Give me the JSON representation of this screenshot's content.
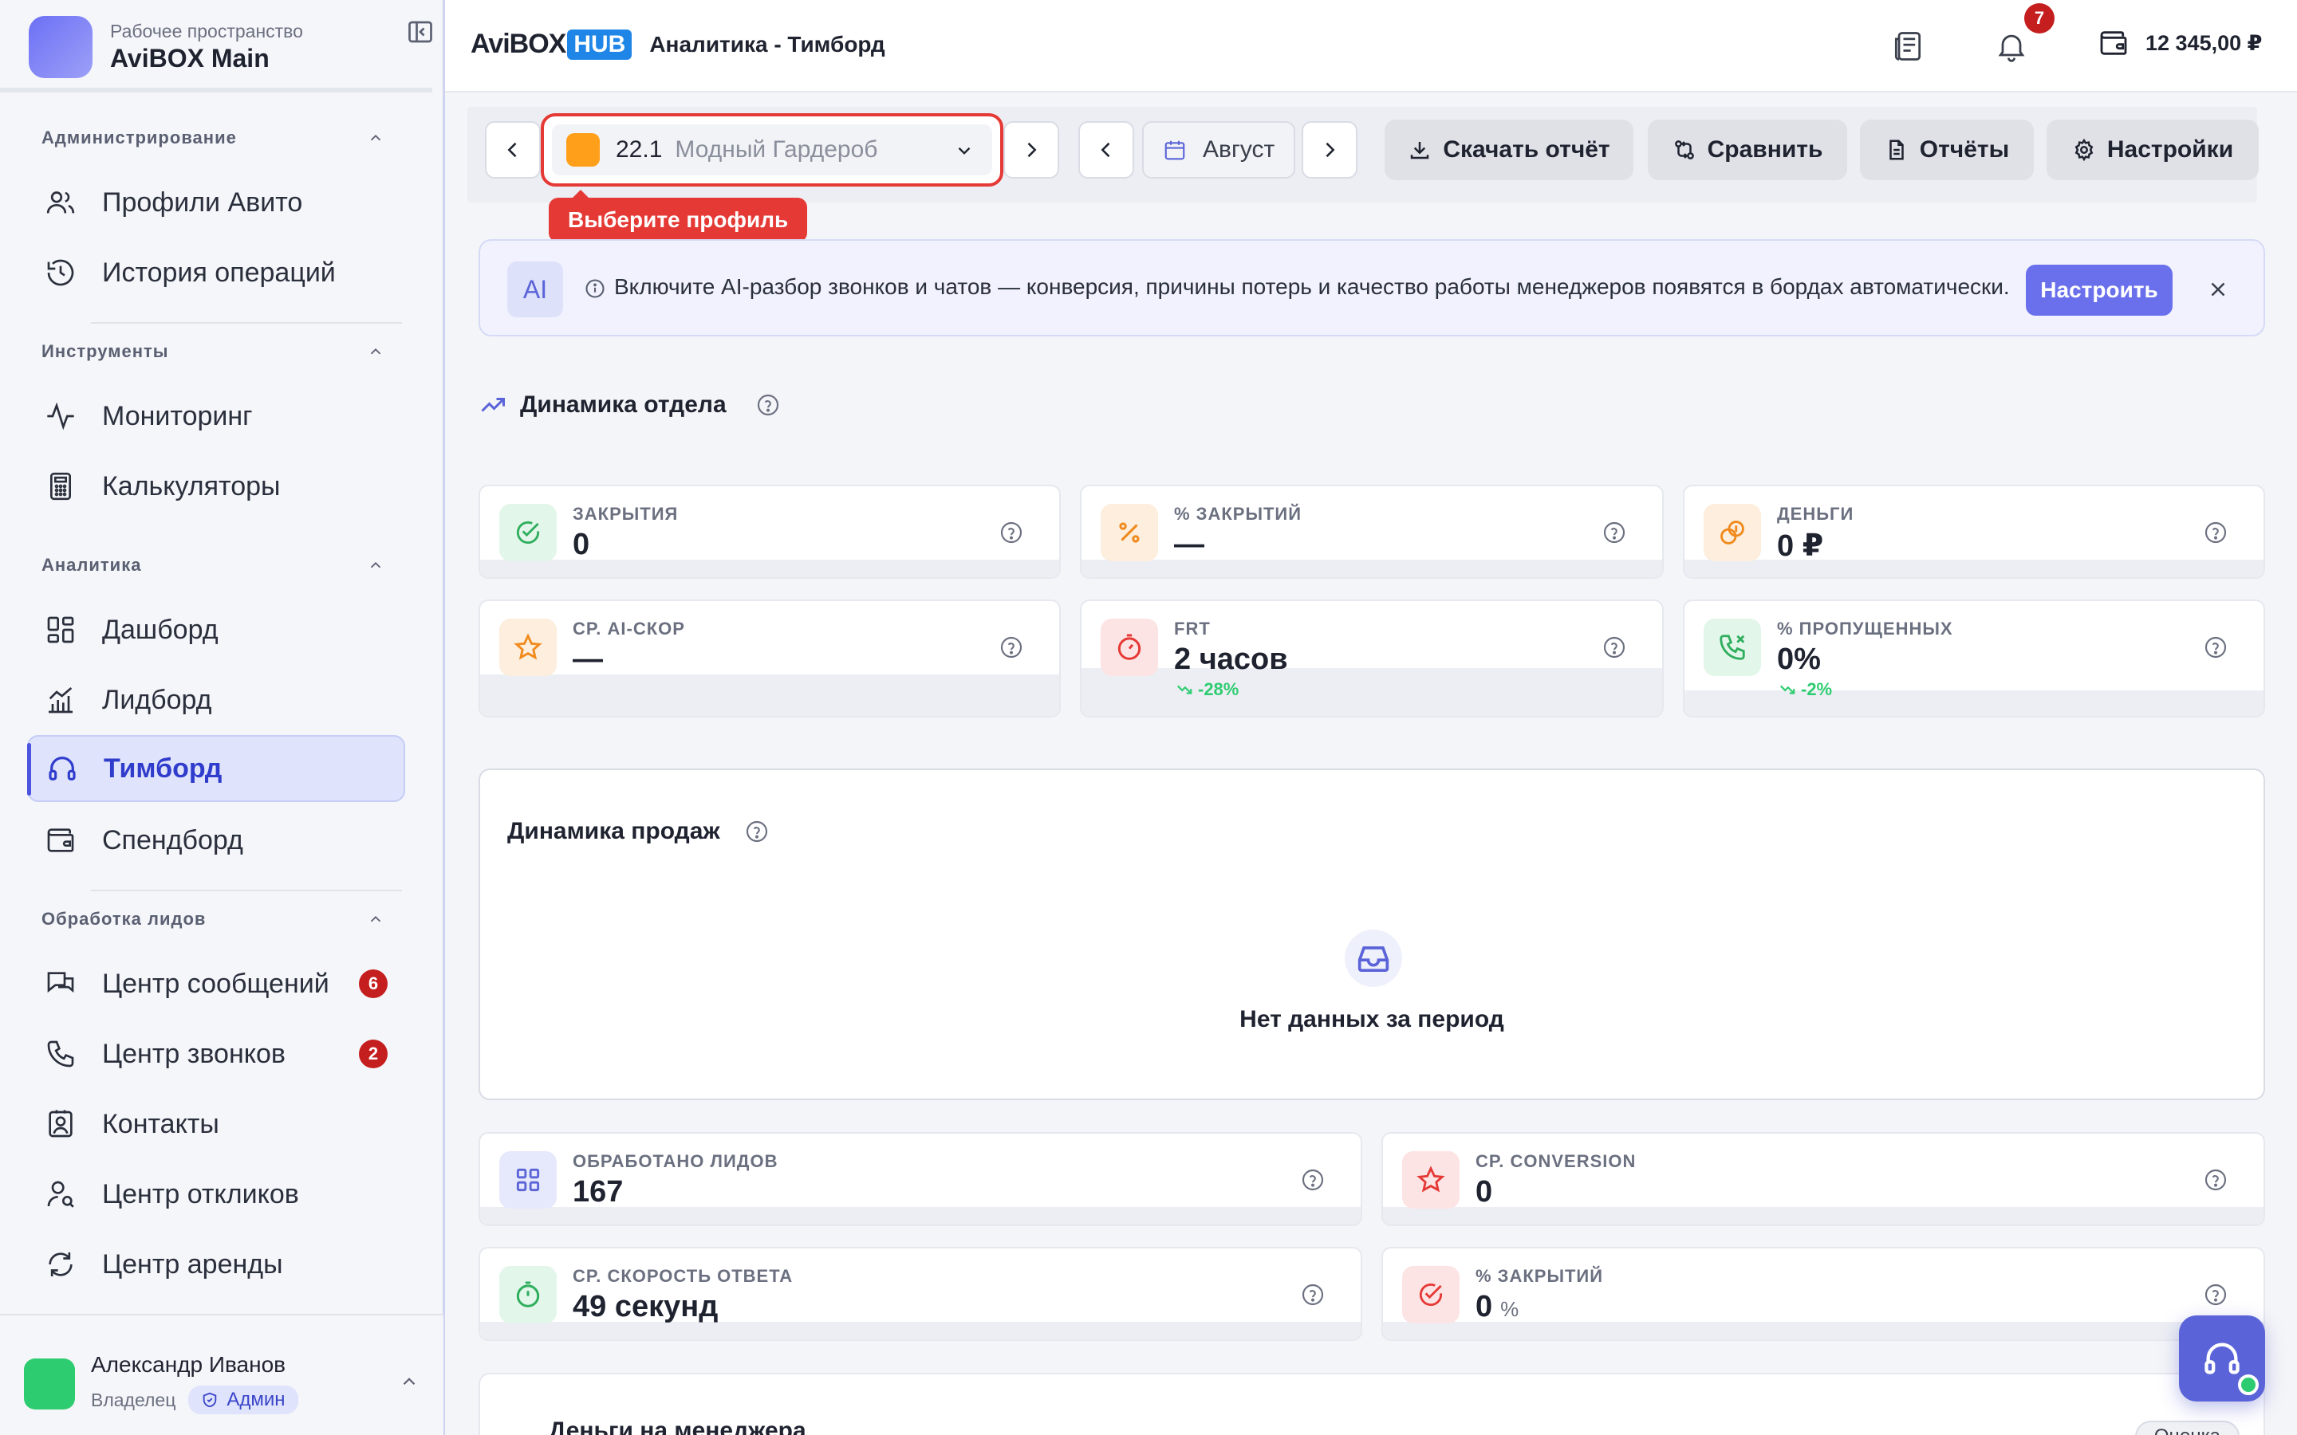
{
  "workspace": {
    "subtitle": "Рабочее пространство",
    "title": "AviBOX Main"
  },
  "sidebar": {
    "sections": [
      {
        "title": "Администрирование",
        "items": [
          {
            "label": "Профили Авито",
            "icon": "users-icon"
          },
          {
            "label": "История операций",
            "icon": "history-icon"
          }
        ]
      },
      {
        "title": "Инструменты",
        "items": [
          {
            "label": "Мониторинг",
            "icon": "activity-icon"
          },
          {
            "label": "Калькуляторы",
            "icon": "calculator-icon"
          }
        ]
      },
      {
        "title": "Аналитика",
        "items": [
          {
            "label": "Дашборд",
            "icon": "dashboard-icon"
          },
          {
            "label": "Лидборд",
            "icon": "chart-icon"
          },
          {
            "label": "Тимборд",
            "icon": "headset-icon",
            "active": true
          },
          {
            "label": "Спендборд",
            "icon": "wallet-icon"
          }
        ]
      },
      {
        "title": "Обработка лидов",
        "items": [
          {
            "label": "Центр сообщений",
            "icon": "messages-icon",
            "badge": "6"
          },
          {
            "label": "Центр звонков",
            "icon": "phone-icon",
            "badge": "2"
          },
          {
            "label": "Контакты",
            "icon": "contact-icon"
          },
          {
            "label": "Центр откликов",
            "icon": "user-search-icon"
          },
          {
            "label": "Центр аренды",
            "icon": "refresh-icon"
          }
        ]
      }
    ]
  },
  "user": {
    "name": "Александр Иванов",
    "role": "Владелец",
    "badge": "Админ"
  },
  "header": {
    "brand_a": "AviBOX",
    "brand_b": "HUB",
    "title": "Аналитика - Тимборд",
    "notifications": "7",
    "balance": "12 345,00 ₽"
  },
  "toolbar": {
    "profile_num": "22.1",
    "profile_name": "Модный Гардероб",
    "profile_tooltip": "Выберите профиль",
    "period": "Август",
    "download": "Скачать отчёт",
    "compare": "Сравнить",
    "reports": "Отчёты",
    "settings": "Настройки"
  },
  "ai_banner": {
    "logo": "AI",
    "text": "Включите AI-разбор звонков и чатов — конверсия, причины потерь и качество работы менеджеров появятся в бордах автоматически.",
    "button": "Настроить"
  },
  "dept": {
    "title": "Динамика отдела"
  },
  "metrics": [
    {
      "label": "ЗАКРЫТИЯ",
      "value": "0",
      "icon": "check-circle-icon",
      "color": "green"
    },
    {
      "label": "% ЗАКРЫТИЙ",
      "value": "—",
      "icon": "percent-icon",
      "color": "orange"
    },
    {
      "label": "ДЕНЬГИ",
      "value": "0 ₽",
      "icon": "coins-icon",
      "color": "orange"
    },
    {
      "label": "СР. AI-СКОР",
      "value": "—",
      "icon": "star-icon",
      "color": "orange"
    },
    {
      "label": "FRT",
      "value": "2 часов",
      "trend": "-28%",
      "icon": "timer-icon",
      "color": "red"
    },
    {
      "label": "% ПРОПУЩЕННЫХ",
      "value": "0%",
      "trend": "-2%",
      "icon": "phone-missed-icon",
      "color": "green"
    }
  ],
  "sales": {
    "title": "Динамика продаж",
    "empty": "Нет данных за период"
  },
  "metrics2": [
    {
      "label": "ОБРАБОТАНО ЛИДОВ",
      "value": "167",
      "icon": "grid-icon",
      "color": "blue"
    },
    {
      "label": "СР. CONVERSION",
      "value": "0",
      "icon": "star-icon",
      "color": "red"
    },
    {
      "label": "СР. СКОРОСТЬ ОТВЕТА",
      "value": "49 секунд",
      "icon": "timer-icon",
      "color": "green"
    },
    {
      "label": "% ЗАКРЫТИЙ",
      "value": "0",
      "unit": "%",
      "icon": "check-circle-icon",
      "color": "red"
    }
  ],
  "bottom": {
    "title": "Деньги на менеджера",
    "chip": "Оценка"
  }
}
